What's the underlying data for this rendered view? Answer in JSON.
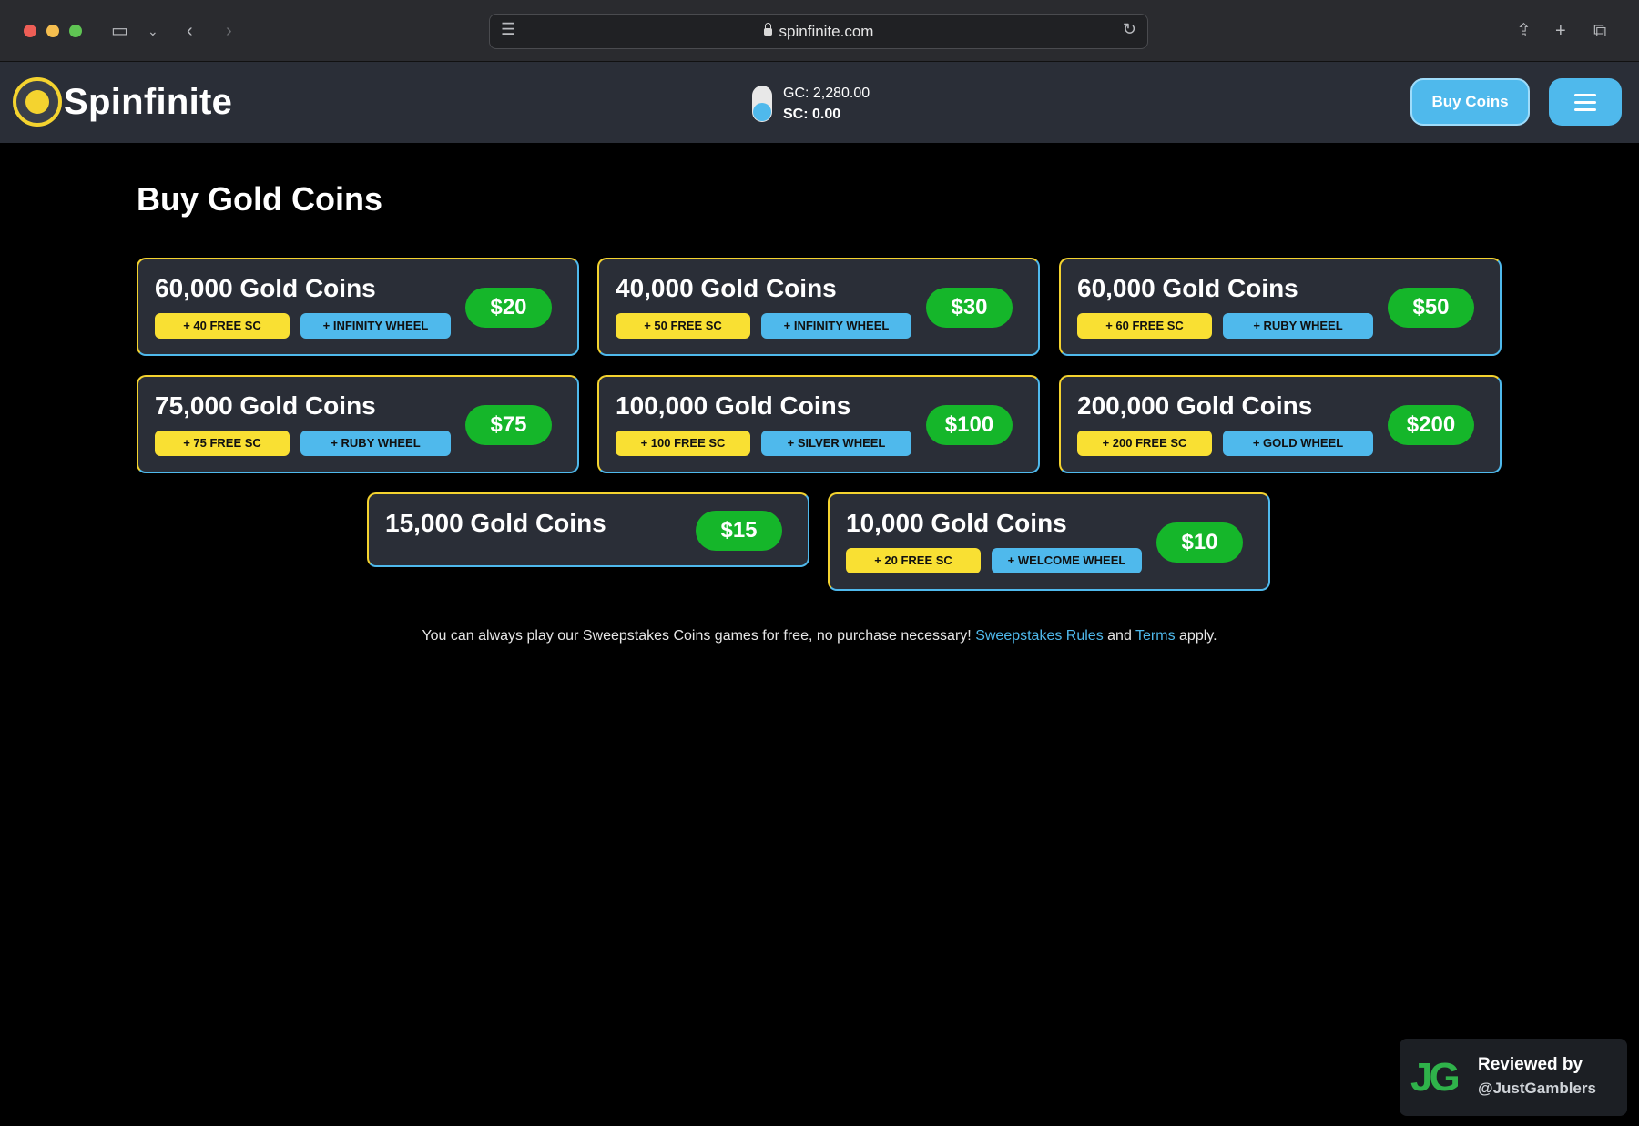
{
  "browser": {
    "url": "spinfinite.com"
  },
  "site": {
    "logo_text": "Spinfinite",
    "balance": {
      "gc": "GC: 2,280.00",
      "sc": "SC: 0.00"
    },
    "buy_button": "Buy Coins"
  },
  "page": {
    "title": "Buy Gold Coins",
    "packages": [
      {
        "name": "60,000 Gold Coins",
        "sc": "+ 40 FREE SC",
        "wheel": "+ INFINITY WHEEL",
        "price": "$20"
      },
      {
        "name": "40,000 Gold Coins",
        "sc": "+ 50 FREE SC",
        "wheel": "+ INFINITY WHEEL",
        "price": "$30"
      },
      {
        "name": "60,000 Gold Coins",
        "sc": "+ 60 FREE SC",
        "wheel": "+ RUBY WHEEL",
        "price": "$50"
      },
      {
        "name": "75,000 Gold Coins",
        "sc": "+ 75 FREE SC",
        "wheel": "+ RUBY WHEEL",
        "price": "$75"
      },
      {
        "name": "100,000 Gold Coins",
        "sc": "+ 100 FREE SC",
        "wheel": "+ SILVER WHEEL",
        "price": "$100"
      },
      {
        "name": "200,000 Gold Coins",
        "sc": "+ 200 FREE SC",
        "wheel": "+ GOLD WHEEL",
        "price": "$200"
      },
      {
        "name": "15,000 Gold Coins",
        "price": "$15"
      },
      {
        "name": "10,000 Gold Coins",
        "sc": "+ 20 FREE SC",
        "wheel": "+ WELCOME WHEEL",
        "price": "$10"
      }
    ],
    "footnote": {
      "text": "You can always play our Sweepstakes Coins games for free, no purchase necessary!",
      "rules_link": "Sweepstakes Rules",
      "and": "and",
      "terms_link": "Terms",
      "apply": "apply."
    }
  },
  "review_badge": {
    "logo": "JG",
    "line1": "Reviewed by",
    "line2": "@JustGamblers"
  },
  "colors": {
    "accent_blue": "#4fb9ec",
    "accent_yellow": "#f9e033",
    "price_green": "#15b62a",
    "card_bg": "#2a2e37"
  }
}
